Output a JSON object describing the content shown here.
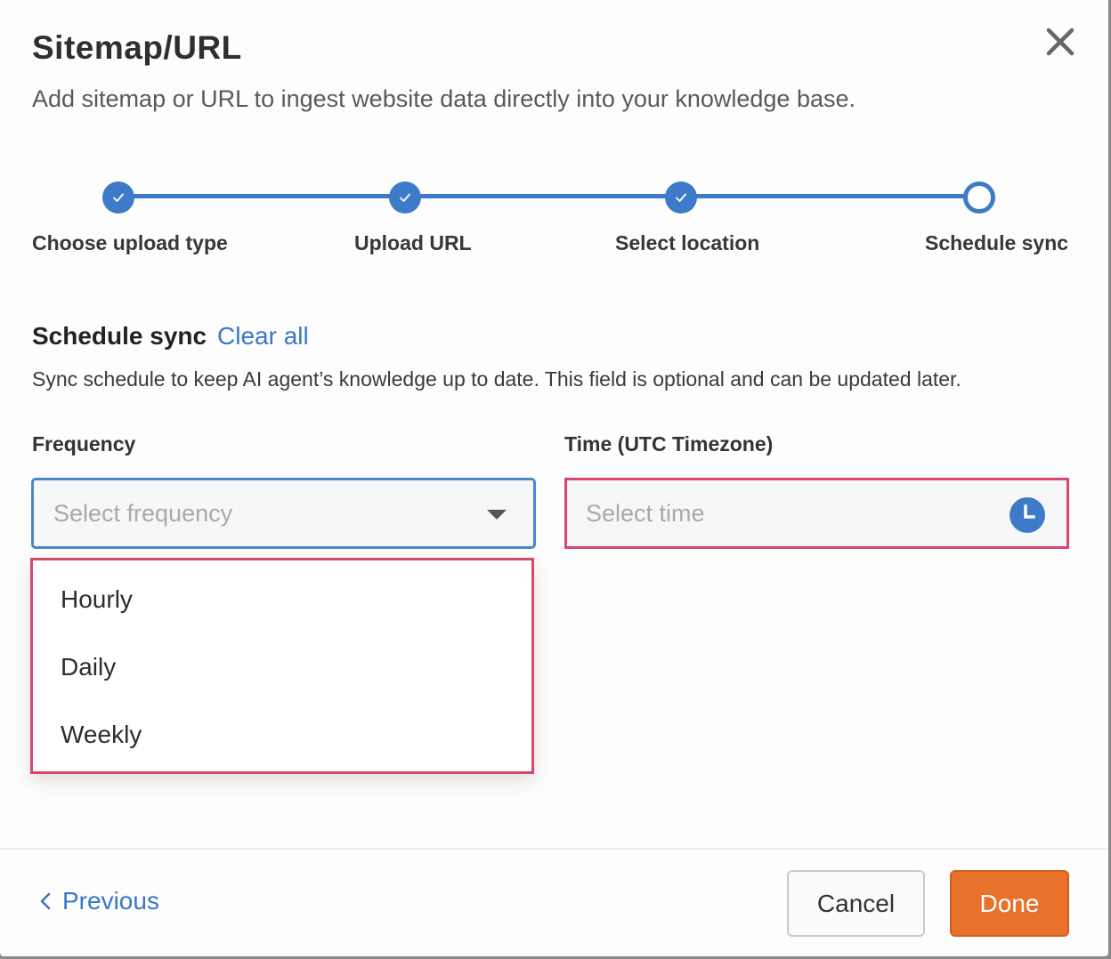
{
  "dialog": {
    "title": "Sitemap/URL",
    "subtitle": "Add sitemap or URL to ingest website data directly into your knowledge base."
  },
  "stepper": {
    "steps": [
      {
        "label": "Choose upload type",
        "state": "complete"
      },
      {
        "label": "Upload URL",
        "state": "complete"
      },
      {
        "label": "Select location",
        "state": "complete"
      },
      {
        "label": "Schedule sync",
        "state": "current"
      }
    ]
  },
  "schedule": {
    "title": "Schedule sync",
    "clear_all": "Clear all",
    "description": "Sync schedule to keep AI agent’s knowledge up to date. This field is optional and can be updated later."
  },
  "frequency": {
    "label": "Frequency",
    "placeholder": "Select frequency",
    "options": [
      "Hourly",
      "Daily",
      "Weekly"
    ]
  },
  "time": {
    "label": "Time (UTC Timezone)",
    "placeholder": "Select time"
  },
  "footer": {
    "previous": "Previous",
    "cancel": "Cancel",
    "done": "Done"
  },
  "colors": {
    "accent": "#3d7bc8",
    "error_outline": "#d6496a",
    "primary_button": "#e8712b"
  }
}
